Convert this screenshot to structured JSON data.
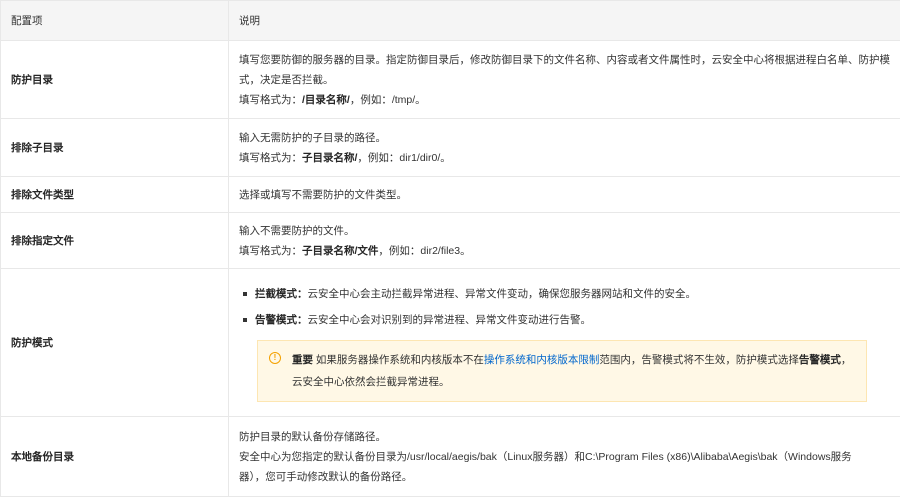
{
  "header": {
    "col1": "配置项",
    "col2": "说明"
  },
  "rows": [
    {
      "name": "防护目录",
      "desc1": "填写您要防御的服务器的目录。指定防御目录后，修改防御目录下的文件名称、内容或者文件属性时，云安全中心将根据进程白名单、防护模",
      "desc2": "式，决定是否拦截。",
      "fmt_prefix": "填写格式为：",
      "fmt_bold": "/目录名称/",
      "fmt_suffix": "，例如：/tmp/。"
    },
    {
      "name": "排除子目录",
      "desc1": "输入无需防护的子目录的路径。",
      "fmt_prefix": "填写格式为：",
      "fmt_bold": "子目录名称/",
      "fmt_suffix": "，例如：dir1/dir0/。"
    },
    {
      "name": "排除文件类型",
      "desc1": "选择或填写不需要防护的文件类型。"
    },
    {
      "name": "排除指定文件",
      "desc1": "输入不需要防护的文件。",
      "fmt_prefix": "填写格式为：",
      "fmt_bold": "子目录名称/文件",
      "fmt_suffix": "，例如：dir2/file3。"
    },
    {
      "name": "防护模式",
      "mode1_bold": "拦截模式：",
      "mode1_text": "云安全中心会主动拦截异常进程、异常文件变动，确保您服务器网站和文件的安全。",
      "mode2_bold": "告警模式：",
      "mode2_text": "云安全中心会对识别到的异常进程、异常文件变动进行告警。",
      "notice": {
        "label": "重要",
        "text_before": " 如果服务器操作系统和内核版本不在",
        "link": "操作系统和内核版本限制",
        "text_mid": "范围内，告警模式将不生效，防护模式选择",
        "bold": "告警模式",
        "text_after": "，云安全中心依然会拦截异常进程。"
      }
    },
    {
      "name": "本地备份目录",
      "desc1": "防护目录的默认备份存储路径。",
      "desc2": "安全中心为您指定的默认备份目录为/usr/local/aegis/bak（Linux服务器）和C:\\Program Files (x86)\\Alibaba\\Aegis\\bak（Windows服务",
      "desc3": "器），您可手动修改默认的备份路径。"
    }
  ]
}
